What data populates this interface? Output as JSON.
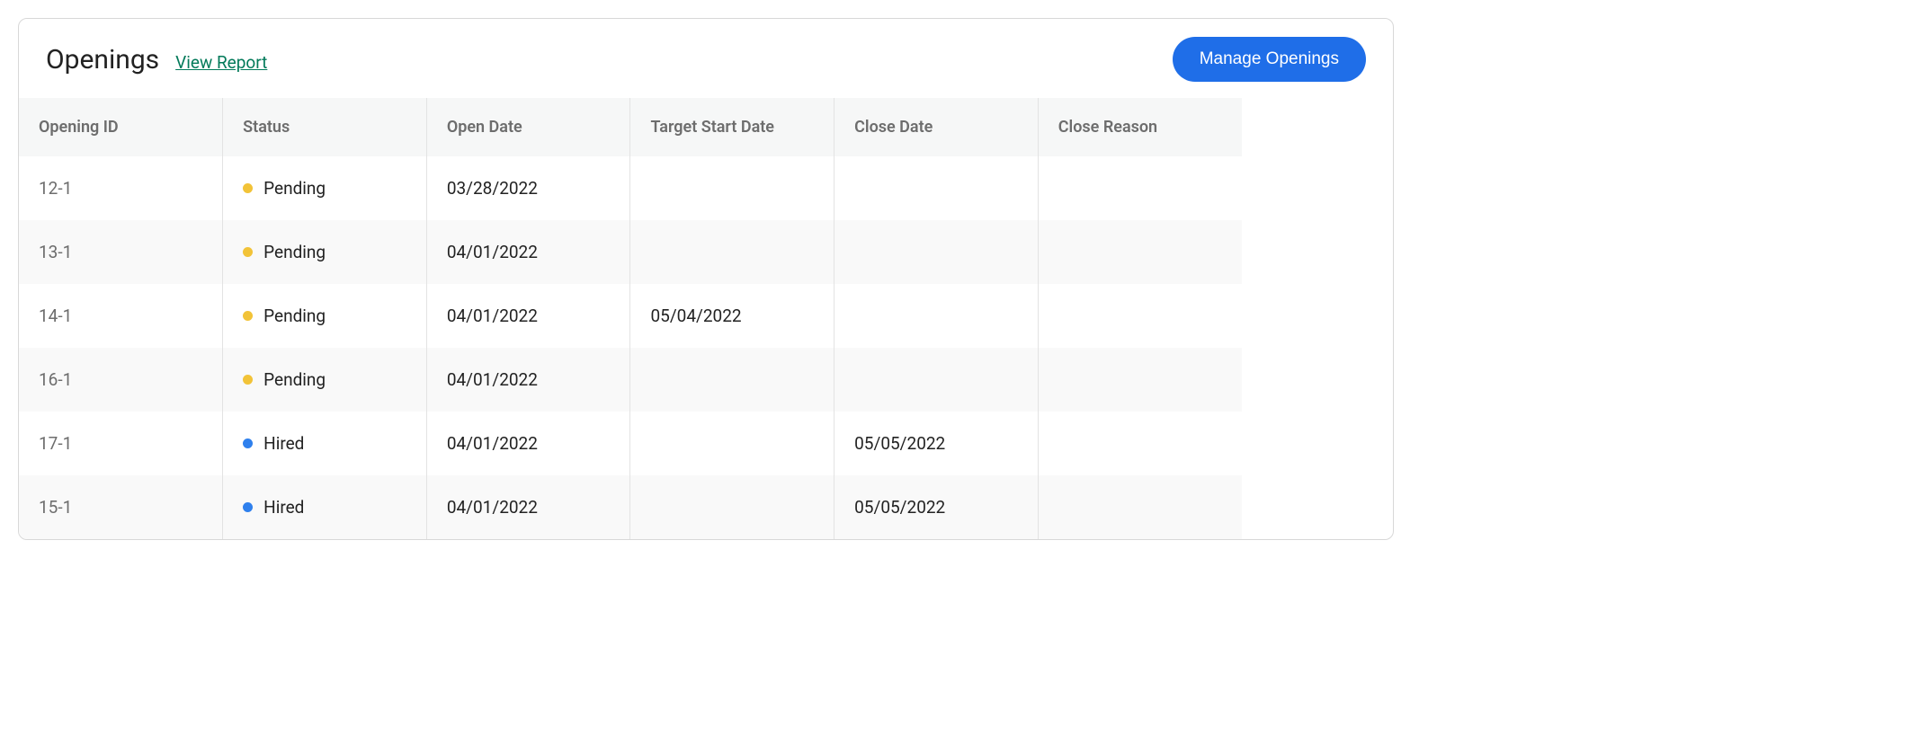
{
  "header": {
    "title": "Openings",
    "viewReport": "View Report",
    "manageButton": "Manage Openings"
  },
  "columns": {
    "id": "Opening ID",
    "status": "Status",
    "openDate": "Open Date",
    "targetStart": "Target Start Date",
    "closeDate": "Close Date",
    "closeReason": "Close Reason"
  },
  "statusColors": {
    "Pending": "#f2c338",
    "Hired": "#2f80ed"
  },
  "rows": [
    {
      "id": "12-1",
      "status": "Pending",
      "openDate": "03/28/2022",
      "targetStart": "",
      "closeDate": "",
      "closeReason": ""
    },
    {
      "id": "13-1",
      "status": "Pending",
      "openDate": "04/01/2022",
      "targetStart": "",
      "closeDate": "",
      "closeReason": ""
    },
    {
      "id": "14-1",
      "status": "Pending",
      "openDate": "04/01/2022",
      "targetStart": "05/04/2022",
      "closeDate": "",
      "closeReason": ""
    },
    {
      "id": "16-1",
      "status": "Pending",
      "openDate": "04/01/2022",
      "targetStart": "",
      "closeDate": "",
      "closeReason": ""
    },
    {
      "id": "17-1",
      "status": "Hired",
      "openDate": "04/01/2022",
      "targetStart": "",
      "closeDate": "05/05/2022",
      "closeReason": ""
    },
    {
      "id": "15-1",
      "status": "Hired",
      "openDate": "04/01/2022",
      "targetStart": "",
      "closeDate": "05/05/2022",
      "closeReason": ""
    }
  ]
}
